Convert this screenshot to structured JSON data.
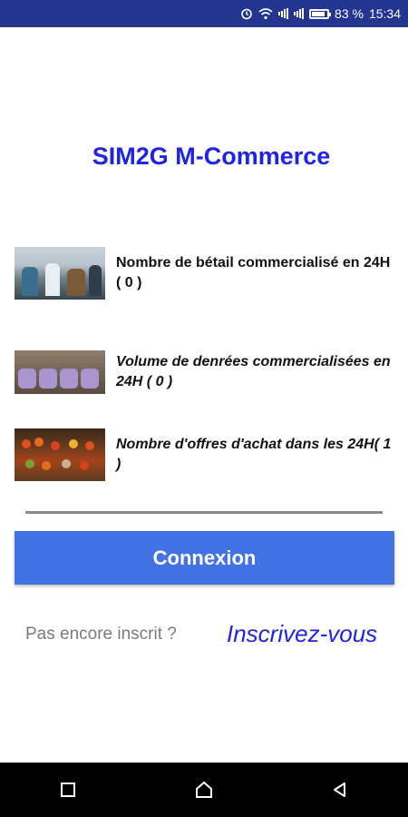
{
  "status_bar": {
    "battery_percent": "83 %",
    "time": "15:34",
    "icons": [
      "alarm-icon",
      "wifi-icon",
      "signal-icon",
      "signal-icon",
      "battery-icon"
    ]
  },
  "app": {
    "title": "SIM2G M-Commerce"
  },
  "stats": [
    {
      "label": "Nombre de bétail commercialisé en 24H ( 0 )",
      "image": "livestock-market-photo"
    },
    {
      "label": "Volume de denrées commercialisées en 24H ( 0 )",
      "image": "grain-sacks-photo"
    },
    {
      "label": "Nombre d'offres d'achat dans les 24H( 1 )",
      "image": "produce-market-photo"
    }
  ],
  "login": {
    "button_label": "Connexion"
  },
  "register": {
    "prompt": "Pas encore inscrit ?",
    "link": "Inscrivez-vous"
  },
  "navigation": {
    "icons": [
      "recent-apps-icon",
      "home-icon",
      "back-icon"
    ]
  },
  "colors": {
    "status_bar": "#24358f",
    "accent_title": "#1f22e8",
    "button": "#4372e4",
    "nav_bar": "#000000"
  }
}
